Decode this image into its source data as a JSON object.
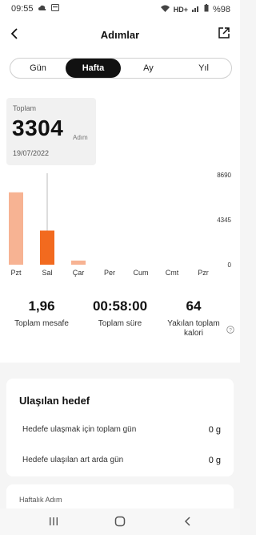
{
  "status": {
    "time": "09:55",
    "icons_left": [
      "cloud-icon",
      "notification-icon"
    ],
    "network": "HD+",
    "battery": "%98"
  },
  "header": {
    "title": "Adımlar",
    "back_icon": "back-arrow-icon",
    "share_icon": "share-icon"
  },
  "tabs": [
    {
      "label": "Gün",
      "active": false
    },
    {
      "label": "Hafta",
      "active": true
    },
    {
      "label": "Ay",
      "active": false
    },
    {
      "label": "Yıl",
      "active": false
    }
  ],
  "summary": {
    "label": "Toplam",
    "value": "3304",
    "unit": "Adım",
    "date": "19/07/2022"
  },
  "chart_data": {
    "type": "bar",
    "categories": [
      "Pzt",
      "Sal",
      "Çar",
      "Per",
      "Cum",
      "Cmt",
      "Pzr"
    ],
    "values": [
      7000,
      3300,
      400,
      0,
      0,
      0,
      0
    ],
    "yticks": [
      "8690",
      "4345",
      "0"
    ],
    "ylim": [
      0,
      8690
    ],
    "selected_index": 1,
    "colors": {
      "normal": "#f7b393",
      "selected": "#f26a1f"
    }
  },
  "stats": [
    {
      "value": "1,96",
      "label": "Toplam mesafe"
    },
    {
      "value": "00:58:00",
      "label": "Toplam süre"
    },
    {
      "value": "64",
      "label": "Yakılan toplam kalori"
    }
  ],
  "goal": {
    "title": "Ulaşılan hedef",
    "rows": [
      {
        "label": "Hedefe ulaşmak için toplam gün",
        "value": "0 g"
      },
      {
        "label": "Hedefe ulaşılan art arda gün",
        "value": "0 g"
      }
    ]
  },
  "weekly": {
    "label": "Haftalık Adım"
  },
  "navbar": {
    "icons": [
      "recent-apps-icon",
      "home-icon",
      "back-icon"
    ]
  }
}
